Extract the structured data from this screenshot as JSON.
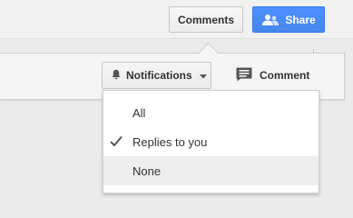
{
  "toolbar": {
    "comments_label": "Comments",
    "share_label": "Share",
    "share_icon": "people-icon",
    "colors": {
      "share_blue": "#4d90fe",
      "share_text": "#ffffff"
    }
  },
  "panel": {
    "notifications_label": "Notifications",
    "notifications_icon": "bell-icon",
    "comment_label": "Comment",
    "comment_icon": "comment-icon"
  },
  "menu": {
    "items": [
      {
        "label": "All",
        "checked": false,
        "highlighted": false
      },
      {
        "label": "Replies to you",
        "checked": true,
        "highlighted": false
      },
      {
        "label": "None",
        "checked": false,
        "highlighted": true
      }
    ]
  }
}
